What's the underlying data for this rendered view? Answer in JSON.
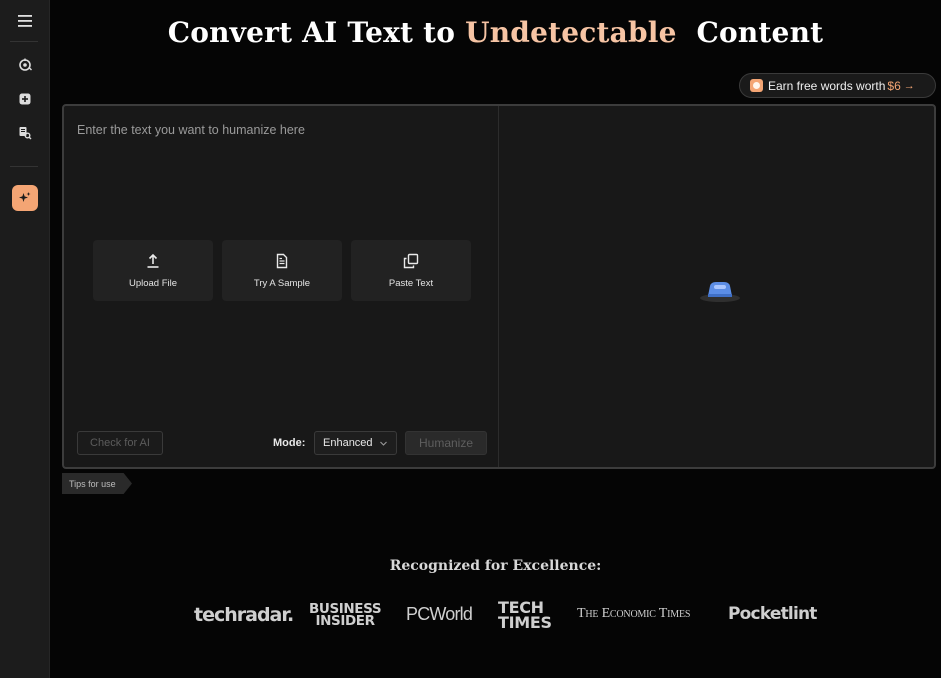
{
  "sidebar": {
    "items": [
      {
        "icon": "menu-icon"
      },
      {
        "icon": "ai-detector-icon"
      },
      {
        "icon": "add-icon"
      },
      {
        "icon": "plagiarism-icon"
      },
      {
        "icon": "humanizer-sparkle-icon",
        "active": true
      }
    ],
    "accent_color": "#f4a574"
  },
  "header": {
    "title_part1": "Convert AI Text to",
    "title_accent": "Undetectable",
    "title_part2": "Content",
    "accent_color": "#f6c4a4"
  },
  "earn": {
    "label": "Earn free words worth",
    "amount": "$6",
    "arrow": "→"
  },
  "editor": {
    "placeholder": "Enter the text you want to humanize here",
    "actions": [
      {
        "label": "Upload File",
        "icon": "upload-icon"
      },
      {
        "label": "Try A Sample",
        "icon": "document-icon"
      },
      {
        "label": "Paste Text",
        "icon": "copy-icon"
      }
    ],
    "check_ai_label": "Check for AI",
    "mode_label": "Mode:",
    "mode_value": "Enhanced",
    "humanize_label": "Humanize"
  },
  "tips": {
    "label": "Tips for use"
  },
  "recognition": {
    "heading": "Recognized for Excellence:",
    "logos": {
      "techradar": "techradar.",
      "bi_line1": "BUSINESS",
      "bi_line2": "INSIDER",
      "pcworld": "PCWorld",
      "tt_line1": "TECH",
      "tt_line2": "TIMES",
      "economic_times": "The Economic Times",
      "pocketlint": "Pocketlint"
    }
  }
}
